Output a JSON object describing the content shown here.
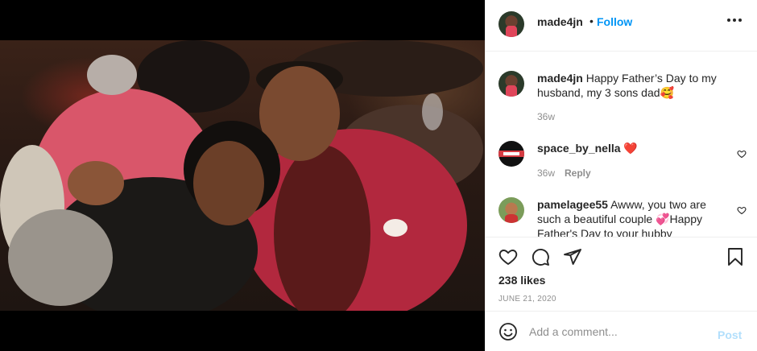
{
  "header": {
    "username": "made4jn",
    "separator": "•",
    "follow_label": "Follow",
    "more_icon": "more-options-icon"
  },
  "media": {
    "image": "photo-of-couple"
  },
  "comments": [
    {
      "username": "made4jn",
      "text": "Happy Father’s Day to my husband, my 3 sons dad🥰",
      "time": "36w",
      "reply": ""
    },
    {
      "username": "space_by_nella",
      "text": "❤️",
      "time": "36w",
      "reply": "Reply"
    },
    {
      "username": "pamelagee55",
      "text": "Awww, you two are such a beautiful couple 💞Happy Father's Day to your hubby",
      "time": "",
      "reply": ""
    }
  ],
  "actions": {
    "likes": "238 likes",
    "date": "JUNE 21, 2020"
  },
  "add_comment": {
    "placeholder": "Add a comment...",
    "post_label": "Post"
  },
  "colors": {
    "accent": "#0095f6",
    "post_disabled": "#b2dffc",
    "secondary_text": "#8e8e8e",
    "primary_text": "#262626"
  }
}
